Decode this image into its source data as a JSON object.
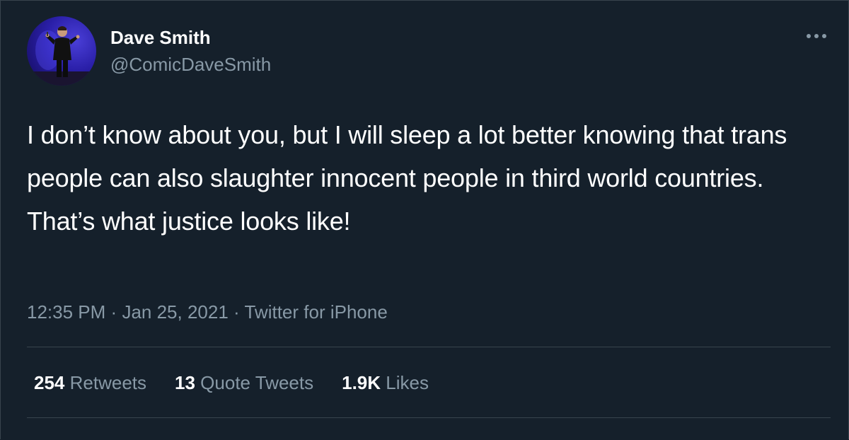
{
  "author": {
    "display_name": "Dave Smith",
    "handle": "@ComicDaveSmith",
    "avatar_icon": "profile-photo"
  },
  "more_icon": "more-horizontal-icon",
  "tweet": {
    "text": "I don’t know about you, but I will sleep a lot better knowing that trans people can also slaughter innocent people in third world countries. That’s what justice looks like!"
  },
  "meta": {
    "time": "12:35 PM",
    "separator": "·",
    "date": "Jan 25, 2021",
    "source": "Twitter for iPhone"
  },
  "stats": [
    {
      "count": "254",
      "label": "Retweets"
    },
    {
      "count": "13",
      "label": "Quote Tweets"
    },
    {
      "count": "1.9K",
      "label": "Likes"
    }
  ],
  "colors": {
    "background": "#15202b",
    "primary_text": "#ffffff",
    "secondary_text": "#8899a6",
    "divider": "#38444d"
  }
}
